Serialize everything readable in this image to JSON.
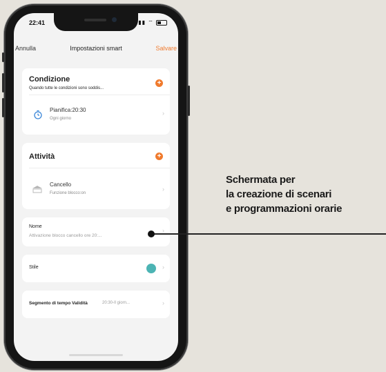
{
  "status_bar": {
    "time": "22:41"
  },
  "navbar": {
    "cancel": "Annulla",
    "title": "Impostazioni smart",
    "save": "Salvare"
  },
  "condition": {
    "title": "Condizione",
    "subtitle": "Quando tutte le condizioni sono soddis...",
    "item_title": "Pianifica:20:30",
    "item_sub": "Ogni giorno"
  },
  "activity": {
    "title": "Attività",
    "item_title": "Cancello",
    "item_sub": "Funzione blocco:on"
  },
  "name_field": {
    "label": "Nome",
    "value": "Attivazione blocco cancello ore 20:..."
  },
  "style_field": {
    "label": "Stile",
    "color": "#4cb4b4"
  },
  "validity_field": {
    "label": "Segmento di tempo Validità",
    "value": "20:30-Il giorn..."
  },
  "annotation": {
    "line1": "Schermata per",
    "line2": "la creazione di scenari",
    "line3": "e programmazioni orarie"
  },
  "colors": {
    "accent": "#f07a2d",
    "background": "#e6e3dc"
  }
}
